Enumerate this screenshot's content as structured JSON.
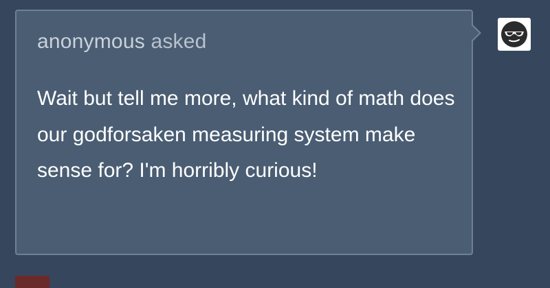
{
  "ask": {
    "asker": "anonymous",
    "verb": "asked",
    "question": "Wait but tell me more, what kind of math does our godforsaken measuring system make sense for? I'm horribly curious!"
  },
  "answerer": {
    "avatar_icon": "sunglasses-face-icon",
    "name": "",
    "follow_label": ""
  },
  "colors": {
    "dashboard_bg": "#36465d",
    "bubble_bg": "#4a5d73",
    "bubble_border": "#6f8196",
    "question_text": "#ffffff",
    "asker_text": "#c9d1db",
    "follow_accent": "#4fb0e8"
  }
}
